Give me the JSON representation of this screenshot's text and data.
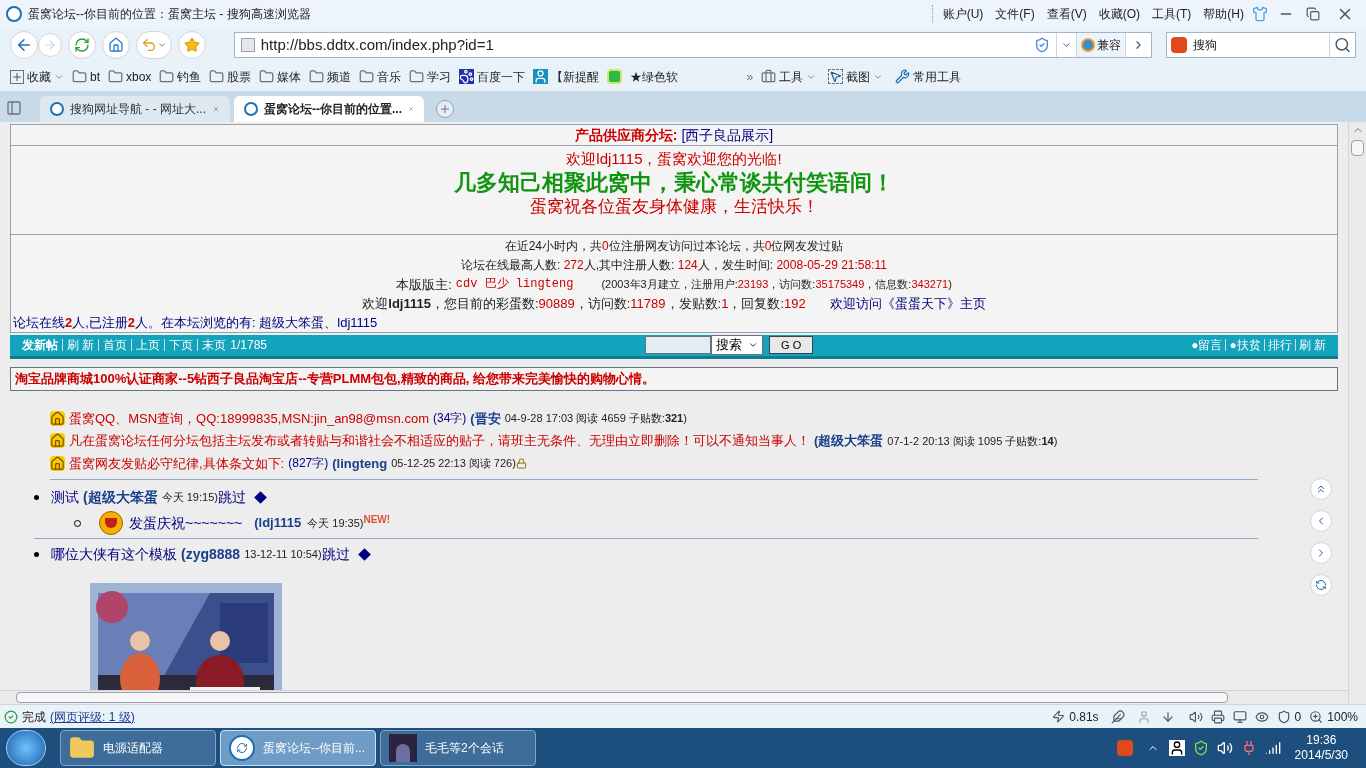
{
  "window": {
    "title": "蛋窝论坛--你目前的位置：蛋窝主坛 - 搜狗高速浏览器"
  },
  "menu": [
    "账户(U)",
    "文件(F)",
    "查看(V)",
    "收藏(O)",
    "工具(T)",
    "帮助(H)"
  ],
  "address": {
    "url": "http://bbs.ddtx.com/index.php?id=1"
  },
  "compat_button": "兼容",
  "search": {
    "value": "搜狗"
  },
  "bookmarks": [
    {
      "label": "收藏",
      "kind": "menu"
    },
    {
      "label": "bt",
      "kind": "folder"
    },
    {
      "label": "xbox",
      "kind": "folder"
    },
    {
      "label": "钓鱼",
      "kind": "folder"
    },
    {
      "label": "股票",
      "kind": "folder"
    },
    {
      "label": "媒体",
      "kind": "folder"
    },
    {
      "label": "频道",
      "kind": "folder"
    },
    {
      "label": "音乐",
      "kind": "folder"
    },
    {
      "label": "学习",
      "kind": "folder"
    },
    {
      "label": "百度一下",
      "kind": "paw"
    },
    {
      "label": "【新提醒",
      "kind": "figure"
    },
    {
      "kind": "badge"
    },
    {
      "label": "★绿色软",
      "kind": "plain"
    }
  ],
  "overflow": "»",
  "tools": [
    {
      "label": "工具",
      "kind": "toolbox",
      "dropdown": true
    },
    {
      "label": "截图",
      "kind": "capture",
      "dropdown": true
    },
    {
      "label": "常用工具",
      "kind": "wrench",
      "dropdown": false
    }
  ],
  "tabs": [
    {
      "title": "搜狗网址导航 - - 网址大...",
      "selected": false
    },
    {
      "title": "蛋窝论坛--你目前的位置...",
      "selected": true
    }
  ],
  "page": {
    "supplier": {
      "label": "产品供应商分坛:",
      "link": "[西子良品展示]"
    },
    "welcome": {
      "greeting": "欢迎ldj1115，蛋窝欢迎您的光临!",
      "motto": "几多知己相聚此窝中，秉心常谈共付笑语间！",
      "wish": "蛋窝祝各位蛋友身体健康，生活快乐！"
    },
    "stats": [
      [
        {
          "text": "在近24小时内，共",
          "highlighted": false
        },
        {
          "text": "0",
          "highlighted": true
        },
        {
          "text": "位注册网友访问过本论坛，共",
          "highlighted": false
        },
        {
          "text": "0",
          "highlighted": true
        },
        {
          "text": "位网友发过贴",
          "highlighted": false
        }
      ],
      [
        {
          "text": "论坛在线最高人数: ",
          "highlighted": false
        },
        {
          "text": "272",
          "highlighted": true
        },
        {
          "text": "人,其中注册人数: ",
          "highlighted": false
        },
        {
          "text": "124",
          "highlighted": true
        },
        {
          "text": "人，发生时间: ",
          "highlighted": false
        },
        {
          "text": "2008-05-29 21:58:11",
          "highlighted": true
        }
      ]
    ],
    "moderators": {
      "label": "本版版主:",
      "names": "cdv 巴少 lingteng",
      "info": [
        {
          "text": "(2003年3月建立，注册用户:",
          "highlighted": false
        },
        {
          "text": "23193",
          "highlighted": true
        },
        {
          "text": "，访问数:",
          "highlighted": false
        },
        {
          "text": "35175349",
          "highlighted": true
        },
        {
          "text": "，信息数:",
          "highlighted": false
        },
        {
          "text": "343271",
          "highlighted": true
        },
        {
          "text": ")",
          "highlighted": false
        }
      ]
    },
    "user_line": [
      {
        "text": "欢迎**ldj1115**，您目前的彩蛋数:",
        "highlighted": false
      },
      {
        "text": "90889",
        "highlighted": true
      },
      {
        "text": "，访问数:",
        "highlighted": false
      },
      {
        "text": "11789",
        "highlighted": true
      },
      {
        "text": "，发贴数:",
        "highlighted": false
      },
      {
        "text": "1",
        "highlighted": true
      },
      {
        "text": "，回复数:",
        "highlighted": false
      },
      {
        "text": "192",
        "highlighted": true
      }
    ],
    "home_link": "欢迎访问《蛋蛋天下》主页",
    "online": [
      {
        "text": "论坛在线",
        "highlighted": false
      },
      {
        "text": "2",
        "highlighted": true
      },
      {
        "text": "人,已注册",
        "highlighted": false
      },
      {
        "text": "2",
        "highlighted": true
      },
      {
        "text": "人。在本坛浏览的有: 超级大笨蛋、ldj1115",
        "highlighted": false
      }
    ],
    "nav_left": [
      {
        "label": "发新帖",
        "kind": "bold"
      },
      {
        "label": "刷 新",
        "kind": "link"
      },
      {
        "label": "首页",
        "kind": "link"
      },
      {
        "label": "上页",
        "kind": "link"
      },
      {
        "label": "下页",
        "kind": "link"
      },
      {
        "label": "末页",
        "kind": "link"
      },
      {
        "label": "1/1785",
        "kind": "pages"
      }
    ],
    "search_select": "搜索",
    "go_button": "G O",
    "nav_right": [
      "●留言",
      "●扶贫",
      "排行",
      "刷 新"
    ],
    "ad": "淘宝品牌商城100%认证商家--5钻西子良品淘宝店--专营PLMM包包,精致的商品, 给您带来完美愉快的购物心情。",
    "pinned": [
      {
        "title": "蛋窝QQ、MSN查询，QQ:18999835,MSN:jin_an98@msn.com",
        "size": "(34字)",
        "author": "(晋安",
        "meta": "04-9-28 17:03 阅读 4659 子贴数:**321**)",
        "locked": false
      },
      {
        "title": "凡在蛋窝论坛任何分坛包括主坛发布或者转贴与和谐社会不相适应的贴子，请班主无条件、无理由立即删除！可以不通知当事人！",
        "author": "(超级大笨蛋",
        "meta": "07-1-2 20:13 阅读 1095 子贴数:**14**)",
        "locked": false
      },
      {
        "title": "蛋窝网友发贴必守纪律,具体条文如下:",
        "size": "(827字)",
        "author": "(lingteng",
        "meta": "05-12-25 22:13 阅读 726)",
        "locked": true
      }
    ],
    "threads": [
      {
        "title": "测试",
        "author": "(超级大笨蛋",
        "meta": "今天 19:15)",
        "skip": "跳过",
        "children": [
          {
            "title": "发蛋庆祝~~~~~~~",
            "author": "(ldj1115",
            "meta": "今天 19:35)",
            "badge": "NEW!"
          }
        ]
      },
      {
        "title": "哪位大侠有这个模板",
        "author": "(zyg8888",
        "meta": "13-12-11 10:54)",
        "skip": "跳过",
        "picture": true
      }
    ]
  },
  "status": {
    "text": "完成",
    "rating": "(网页评级: 1 级)",
    "load_time": "0.81s",
    "blocked": "0",
    "zoom": "100%"
  },
  "taskbar": [
    {
      "label": "电源适配器",
      "kind": "folder",
      "selected": false
    },
    {
      "label": "蛋窝论坛--你目前...",
      "kind": "browser",
      "selected": true
    },
    {
      "label": "毛毛等2个会话",
      "kind": "chat",
      "selected": false
    }
  ],
  "clock": {
    "time": "19:36",
    "date": "2014/5/30"
  }
}
